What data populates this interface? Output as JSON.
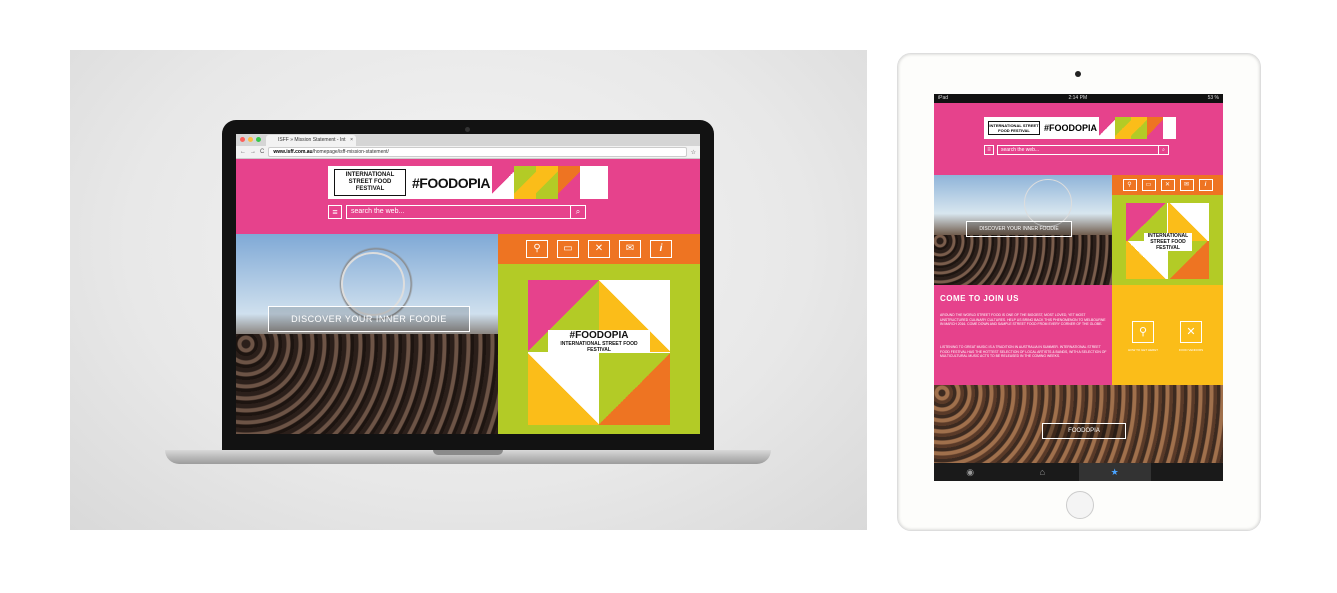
{
  "colors": {
    "pink": "#e6428c",
    "orange": "#ee7422",
    "green": "#b3cb26",
    "yellow": "#fbbd19"
  },
  "laptop": {
    "browser": {
      "tab_title": "ISFF » Mission Statement - Int",
      "tab_close": "×",
      "nav_back": "←",
      "nav_forward": "→",
      "nav_reload": "C",
      "url_domain": "www.isff.com.au",
      "url_path": "/homepage/isff-mission-statement/",
      "star_icon": "☆"
    },
    "site": {
      "festival_name": "INTERNATIONAL STREET FOOD FESTIVAL",
      "brand": "#FOODOPIA",
      "menu_icon": "≡",
      "search_placeholder": "search the web...",
      "search_icon": "⌕",
      "discover_label": "DISCOVER YOUR INNER FOODIE",
      "icons": {
        "pin": "⚲",
        "car": "▭",
        "utensils": "✕",
        "mail": "✉",
        "info": "i"
      },
      "poster": {
        "brand": "#FOODOPIA",
        "festival_name": "INTERNATIONAL STREET FOOD FESTIVAL"
      }
    }
  },
  "tablet": {
    "status": {
      "left": "iPad",
      "center": "2:14 PM",
      "right": "53 %"
    },
    "site": {
      "festival_name": "INTERNATIONAL STREET FOOD FESTIVAL",
      "brand": "#FOODOPIA",
      "menu_icon": "≡",
      "search_placeholder": "search the web...",
      "search_icon": "⌕",
      "discover_label": "DISCOVER YOUR INNER FOODIE",
      "icons": {
        "pin": "⚲",
        "car": "▭",
        "utensils": "✕",
        "mail": "✉",
        "info": "i"
      },
      "join_title": "COME TO JOIN US",
      "join_p1": "AROUND THE WORLD STREET FOOD IS ONE OF THE BIGGEST, MOST LOVED, YET MOST UNSTRUCTURED CULINARY CULTURES. HELP US BRING BACK THIS PHENOMENON TO MELBOURNE IN MARCH 2016. COME DOWN AND SAMPLE STREET FOOD FROM EVERY CORNER OF THE GLOBE.",
      "join_p2": "LISTENING TO GREAT MUSIC IS A TRADITION IN AUSTRALIA IN SUMMER. INTERNATIONAL STREET FOOD FESTIVAL HAS THE HOTTEST SELECTION OF LOCAL ARTISTS & BANDS, WITH A SELECTION OF MULTICULTURAL MUSIC ACTS TO BE RELEASED IN THE COMING WEEKS.",
      "how_to_get": "HOW TO GET HERE?",
      "food_vendors": "FOOD VENDORS",
      "foodopia_button": "FOODOPIA",
      "tabbar": {
        "camera": "◉",
        "home": "⌂",
        "star": "★"
      }
    }
  }
}
